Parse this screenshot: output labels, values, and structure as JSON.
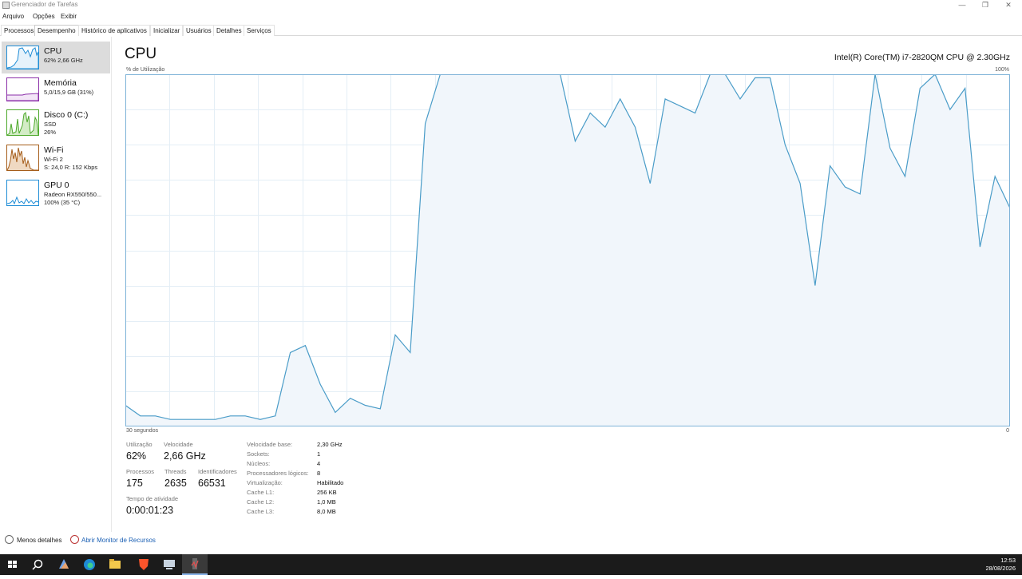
{
  "window": {
    "title": "Gerenciador de Tarefas",
    "controls": [
      "minimize-icon",
      "restore-icon",
      "close-icon"
    ]
  },
  "menu": [
    "Arquivo",
    "Opções",
    "Exibir"
  ],
  "tabs": [
    "Processos",
    "Desempenho",
    "Histórico de aplicativos",
    "Inicializar",
    "Usuários",
    "Detalhes",
    "Serviços"
  ],
  "active_tab": "Desempenho",
  "sidebar": {
    "items": [
      {
        "name": "CPU",
        "lines": [
          "62% 2,66 GHz"
        ],
        "color": "#1f8dd6"
      },
      {
        "name": "Memória",
        "lines": [
          "5,0/15,9 GB (31%)"
        ],
        "color": "#8b2fa8"
      },
      {
        "name": "Disco 0 (C:)",
        "lines": [
          "SSD",
          "26%"
        ],
        "color": "#4ca82a"
      },
      {
        "name": "Wi-Fi",
        "lines": [
          "Wi-Fi 2",
          "S: 24,0 R: 152 Kbps"
        ],
        "color": "#a55d1a"
      },
      {
        "name": "GPU 0",
        "lines": [
          "Radeon RX550/550...",
          "100% (35 °C)"
        ],
        "color": "#1f8dd6"
      }
    ]
  },
  "main": {
    "title": "CPU",
    "model": "Intel(R) Core(TM) i7-2820QM CPU @ 2.30GHz",
    "y_label": "% de Utilização",
    "y_max": "100%",
    "x_left": "30 segundos",
    "x_right": "0",
    "line_color": "#4a9cc8",
    "fill_color": "#f1f6fb"
  },
  "chart_data": {
    "type": "area",
    "title": "CPU",
    "ylabel": "% de Utilização",
    "xlabel": "",
    "ylim": [
      0,
      100
    ],
    "grid": true,
    "values": [
      6,
      3,
      3,
      2,
      2,
      2,
      2,
      3,
      3,
      2,
      3,
      21,
      23,
      12,
      4,
      8,
      6,
      5,
      26,
      21,
      86,
      100,
      100,
      100,
      100,
      100,
      100,
      100,
      100,
      100,
      81,
      89,
      85,
      93,
      85,
      69,
      93,
      91,
      89,
      100,
      100,
      93,
      99,
      99,
      80,
      69,
      40,
      74,
      68,
      66,
      100,
      79,
      71,
      96,
      100,
      90,
      96,
      51,
      71,
      62
    ]
  },
  "stats": {
    "utilizacao": {
      "label": "Utilização",
      "value": "62%"
    },
    "velocidade": {
      "label": "Velocidade",
      "value": "2,66 GHz"
    },
    "processos": {
      "label": "Processos",
      "value": "175"
    },
    "threads": {
      "label": "Threads",
      "value": "2635"
    },
    "identificadores": {
      "label": "Identificadores",
      "value": "66531"
    },
    "tempo": {
      "label": "Tempo de atividade",
      "value": "0:00:01:23"
    }
  },
  "specs": [
    {
      "key": "Velocidade base:",
      "value": "2,30 GHz"
    },
    {
      "key": "Sockets:",
      "value": "1"
    },
    {
      "key": "Núcleos:",
      "value": "4"
    },
    {
      "key": "Processadores lógicos:",
      "value": "8"
    },
    {
      "key": "Virtualização:",
      "value": "Habilitado"
    },
    {
      "key": "Cache L1:",
      "value": "256 KB"
    },
    {
      "key": "Cache L2:",
      "value": "1,0 MB"
    },
    {
      "key": "Cache L3:",
      "value": "8,0 MB"
    }
  ],
  "footer": {
    "less_details": "Menos detalhes",
    "resource_monitor": "Abrir Monitor de Recursos"
  },
  "taskbar": {
    "icons": [
      "windows-start-icon",
      "search-icon",
      "widgets-icon",
      "edge-icon",
      "file-explorer-icon",
      "brave-icon",
      "network-icon",
      "task-manager-icon"
    ],
    "time": "12:53",
    "date": "28/08/2026"
  }
}
